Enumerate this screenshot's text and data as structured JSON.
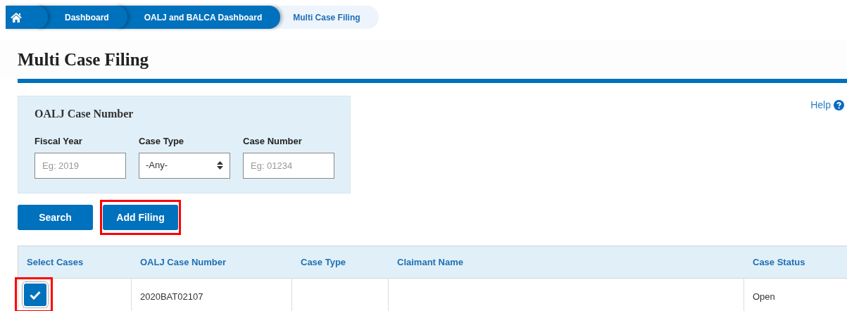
{
  "breadcrumb": [
    {
      "kind": "home"
    },
    {
      "kind": "link",
      "label": "Dashboard"
    },
    {
      "kind": "link",
      "label": "OALJ and BALCA Dashboard"
    },
    {
      "kind": "current",
      "label": "Multi Case Filing"
    }
  ],
  "page_title": "Multi Case Filing",
  "help": "Help",
  "search_panel": {
    "title": "OALJ Case Number",
    "fields": [
      {
        "kind": "text",
        "label": "Fiscal Year",
        "placeholder": "Eg: 2019"
      },
      {
        "kind": "select",
        "label": "Case Type",
        "value": "-Any-"
      },
      {
        "kind": "text",
        "label": "Case Number",
        "placeholder": "Eg: 01234"
      }
    ]
  },
  "buttons": [
    {
      "label": "Search",
      "highlighted": false
    },
    {
      "label": "Add Filing",
      "highlighted": true
    }
  ],
  "table": {
    "columns": [
      "Select Cases",
      "OALJ Case Number",
      "Case Type",
      "Claimant Name",
      "Case Status"
    ],
    "rows": [
      {
        "checked": true,
        "highlighted": true,
        "case_number": "2020BAT02107",
        "case_status": "Open"
      }
    ]
  }
}
